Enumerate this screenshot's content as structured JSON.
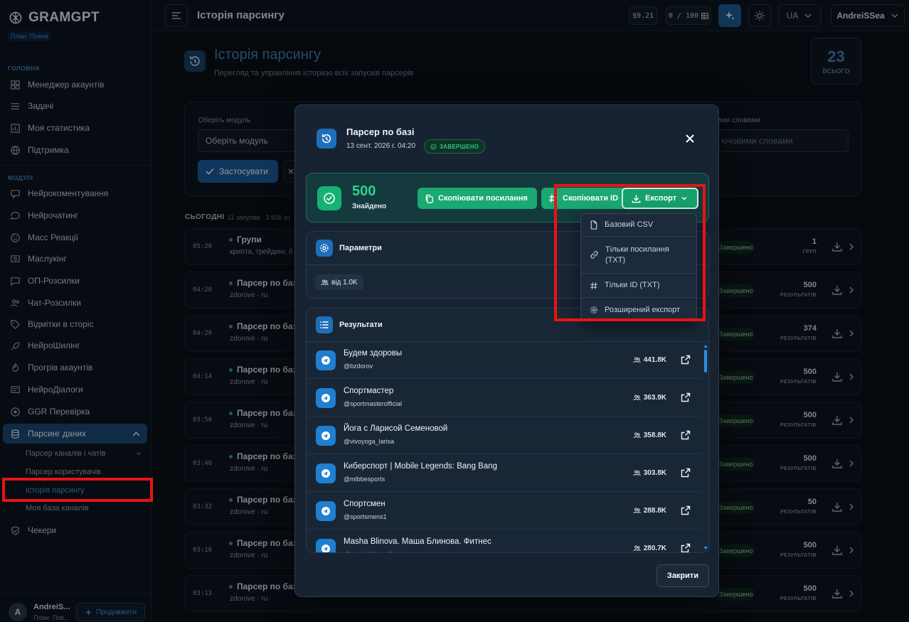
{
  "app": {
    "name": "GRAMGPT",
    "plan_chip": "План: Повна"
  },
  "sidebar": {
    "section_main": "ГОЛОВНА",
    "section_modules": "МОДУЛІ",
    "main_items": [
      {
        "label": "Менеджер акаунтів",
        "icon": "grid-icon"
      },
      {
        "label": "Задачі",
        "icon": "list-icon"
      },
      {
        "label": "Моя статистика",
        "icon": "chart-icon"
      },
      {
        "label": "Підтримка",
        "icon": "globe-icon"
      }
    ],
    "module_items": [
      {
        "label": "Нейрокоментування",
        "icon": "comment-icon"
      },
      {
        "label": "Нейрочатинг",
        "icon": "chat-icon"
      },
      {
        "label": "Масс Реакції",
        "icon": "smile-icon"
      },
      {
        "label": "Маслукінг",
        "icon": "eye-icon"
      },
      {
        "label": "ОП-Розсилки",
        "icon": "message-icon"
      },
      {
        "label": "Чат-Розсилки",
        "icon": "users-icon"
      },
      {
        "label": "Відмітки в сторіс",
        "icon": "tag-icon"
      },
      {
        "label": "НейроШилінг",
        "icon": "rocket-icon"
      },
      {
        "label": "Прогрів акаунтів",
        "icon": "flame-icon"
      },
      {
        "label": "НейроДіалоги",
        "icon": "dialog-icon"
      },
      {
        "label": "GGR Перевірка",
        "icon": "star-icon"
      },
      {
        "label": "Парсинг даних",
        "icon": "database-icon",
        "active": true
      }
    ],
    "sub_items": [
      {
        "label": "Парсер каналів і чатів"
      },
      {
        "label": "Парсер користувачів"
      },
      {
        "label": "Історія парсингу",
        "active": true
      },
      {
        "label": "Моя база каналів"
      }
    ],
    "checkers": {
      "label": "Чекери",
      "icon": "shield-check-icon"
    },
    "user": {
      "initial": "A",
      "name": "AndreiS...",
      "plan": "План: Пов...",
      "upgrade": "Продовжити"
    }
  },
  "topbar": {
    "title": "Історія парсингу",
    "balance": "$9.21",
    "quota": "0 / 100",
    "language": "UA",
    "username": "AndreiSSea"
  },
  "page": {
    "title": "Історія парсингу",
    "subtitle": "Перегляд та управління історією всіх запусків парсерів",
    "total_count": "23",
    "total_label": "ВСЬОГО",
    "filter": {
      "module_label": "Оберіть модуль",
      "module_value": "Оберіть модуль",
      "keywords_label": "ими словами",
      "keywords_placeholder": "ючовими словами",
      "apply": "Застосувати"
    },
    "day_label": "СЬОГОДНІ",
    "day_meta": "11 запусків · 3 926 зн"
  },
  "history_rows": [
    {
      "time": "05:20",
      "title": "Групи",
      "sub": "крипта, трейдинг, б",
      "status": "Завершено",
      "count": "1",
      "unit": "ГРУП"
    },
    {
      "time": "04:20",
      "title": "Парсер по базі",
      "sub": "zdorove · ru",
      "status": "Завершено",
      "count": "500",
      "unit": "РЕЗУЛЬТАТІВ"
    },
    {
      "time": "04:20",
      "title": "Парсер по базі",
      "sub": "zdorove · ru",
      "status": "Завершено",
      "count": "374",
      "unit": "РЕЗУЛЬТАТІВ"
    },
    {
      "time": "04:14",
      "title": "Парсер по базі",
      "sub": "zdorove · ru",
      "status": "Завершено",
      "count": "500",
      "unit": "РЕЗУЛЬТАТІВ"
    },
    {
      "time": "03:50",
      "title": "Парсер по базі",
      "sub": "zdorove · ru",
      "status": "Завершено",
      "count": "500",
      "unit": "РЕЗУЛЬТАТІВ"
    },
    {
      "time": "03:46",
      "title": "Парсер по базі",
      "sub": "zdorove · ru",
      "status": "Завершено",
      "count": "500",
      "unit": "РЕЗУЛЬТАТІВ"
    },
    {
      "time": "03:32",
      "title": "Парсер по базі",
      "sub": "zdorove · ru",
      "status": "Завершено",
      "count": "50",
      "unit": "РЕЗУЛЬТАТІВ"
    },
    {
      "time": "03:16",
      "title": "Парсер по базі",
      "sub": "zdorove · ru",
      "status": "Завершено",
      "count": "500",
      "unit": "РЕЗУЛЬТАТІВ"
    },
    {
      "time": "03:13",
      "title": "Парсер по базі",
      "sub": "zdorove · ru",
      "status": "Завершено",
      "count": "500",
      "unit": "РЕЗУЛЬТАТІВ"
    }
  ],
  "modal": {
    "title": "Парсер по базі",
    "date": "13 сент. 2026 г. 04:20",
    "status": "ЗАВЕРШЕНО",
    "found_count": "500",
    "found_label": "Знайдено",
    "copy_links": "Скопіювати посилання",
    "copy_ids": "Скопіювати ID",
    "export": "Експорт",
    "params_title": "Параметри",
    "param_chip": "від 1.0K",
    "results_title": "Результати",
    "close": "Закрити",
    "results": [
      {
        "name": "Будем здоровы",
        "username": "@bzdorov",
        "subscribers": "441.8K"
      },
      {
        "name": "Спортмастер",
        "username": "@sportmasterofficial",
        "subscribers": "363.9K"
      },
      {
        "name": "Йога с Ларисой Семеновой",
        "username": "@vivoyoga_larisa",
        "subscribers": "358.8K"
      },
      {
        "name": "Киберспорт | Mobile Legends: Bang Bang",
        "username": "@mlbbesports",
        "subscribers": "303.8K"
      },
      {
        "name": "Спортсмен",
        "username": "@sportsmens1",
        "subscribers": "288.8K"
      },
      {
        "name": "Masha Blinova. Маша Блинова. Фитнес",
        "username": "@mashablinovafit",
        "subscribers": "280.7K"
      }
    ]
  },
  "export_menu": {
    "items": [
      {
        "label": "Базовий CSV",
        "icon": "file-icon"
      },
      {
        "label": "Тільки посилання (TXT)",
        "icon": "link-icon"
      },
      {
        "label": "Тільки ID (TXT)",
        "icon": "hash-icon"
      },
      {
        "label": "Розширений експорт",
        "icon": "gear-icon"
      }
    ]
  },
  "colors": {
    "accent": "#1e6fb8",
    "success": "#1aa873",
    "highlight": "#e81414"
  }
}
